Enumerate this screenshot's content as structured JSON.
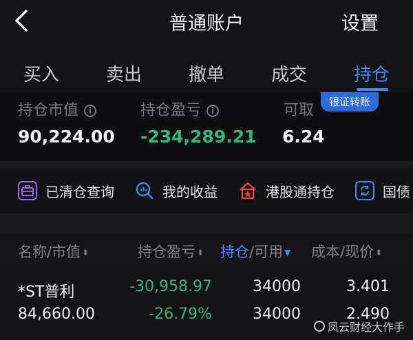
{
  "header": {
    "title": "普通账户",
    "settings_label": "设置"
  },
  "tabs": [
    {
      "label": "买入",
      "active": false
    },
    {
      "label": "卖出",
      "active": false
    },
    {
      "label": "撤单",
      "active": false
    },
    {
      "label": "成交",
      "active": false
    },
    {
      "label": "持仓",
      "active": true
    }
  ],
  "account": {
    "market_value_label": "持仓市值",
    "market_value": "90,224.00",
    "pnl_label": "持仓盈亏",
    "pnl": "-234,289.21",
    "withdrawable_label": "可取",
    "withdrawable": "6.24",
    "bank_transfer_label": "银证转账"
  },
  "quick_actions": [
    {
      "label": "已清仓查询",
      "icon": "briefcase-icon",
      "color": "#9a6cf0"
    },
    {
      "label": "我的收益",
      "icon": "chart-search-icon",
      "color": "#3d89f3"
    },
    {
      "label": "港股通持仓",
      "icon": "house-star-icon",
      "color": "#e2483f"
    },
    {
      "label": "国债",
      "icon": "refresh-icon",
      "color": "#3d89f3"
    }
  ],
  "table": {
    "headers": {
      "name": "名称/市值",
      "pnl": "持仓盈亏",
      "position": "持仓",
      "available": "/可用",
      "cost": "成本/现价"
    },
    "rows": [
      {
        "name": "*ST普利",
        "market_value": "84,660.00",
        "pnl": "-30,958.97",
        "pnl_pct": "-26.79%",
        "position": "34000",
        "available": "34000",
        "cost": "3.401",
        "price": "2.490"
      }
    ]
  },
  "watermark": "凤云财经大作手",
  "colors": {
    "accent": "#3d89f3",
    "loss": "#36b37e",
    "background": "#131316"
  }
}
